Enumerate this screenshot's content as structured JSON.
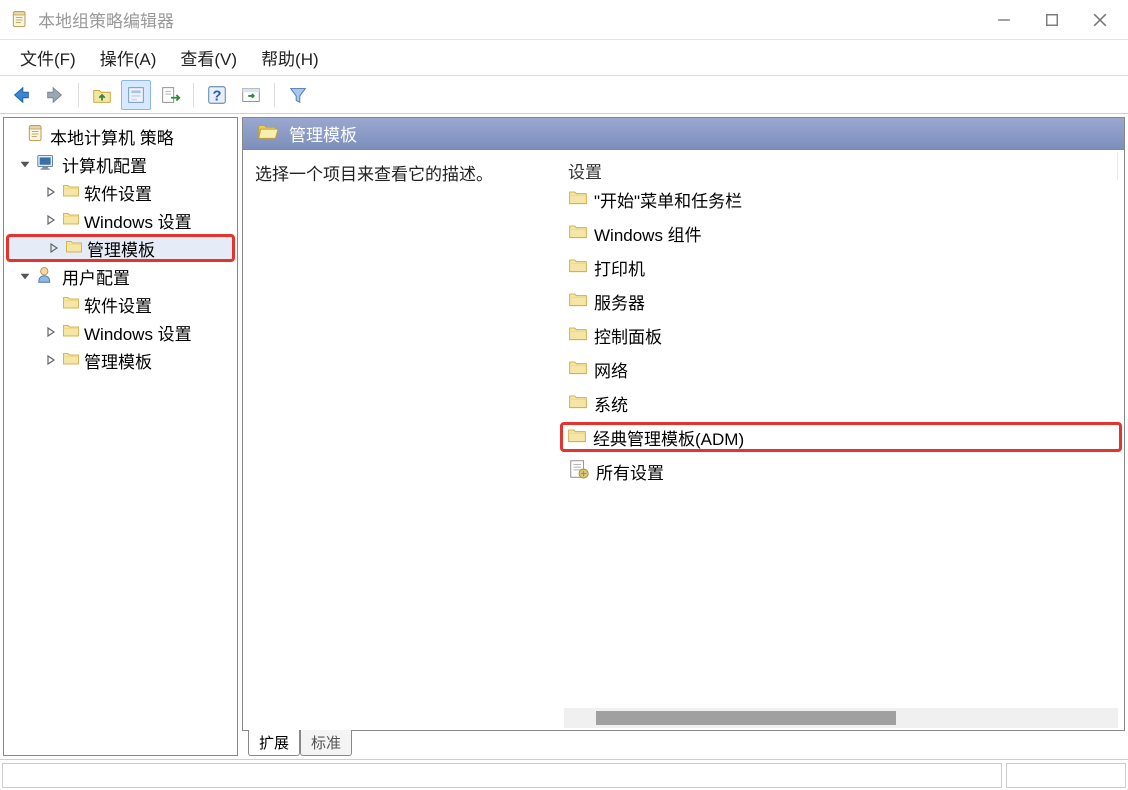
{
  "window": {
    "title": "本地组策略编辑器"
  },
  "menu": {
    "file": "文件(F)",
    "action": "操作(A)",
    "view": "查看(V)",
    "help": "帮助(H)"
  },
  "tree": {
    "root": "本地计算机 策略",
    "computer": "计算机配置",
    "computer_children": {
      "software": "软件设置",
      "windows": "Windows 设置",
      "admin_templates": "管理模板"
    },
    "user": "用户配置",
    "user_children": {
      "software": "软件设置",
      "windows": "Windows 设置",
      "admin_templates": "管理模板"
    }
  },
  "right": {
    "header": "管理模板",
    "description_prompt": "选择一个项目来查看它的描述。",
    "settings_header": "设置",
    "items": {
      "start_taskbar": "\"开始\"菜单和任务栏",
      "windows_components": "Windows 组件",
      "printers": "打印机",
      "servers": "服务器",
      "control_panel": "控制面板",
      "network": "网络",
      "system": "系统",
      "classic_adm": "经典管理模板(ADM)",
      "all_settings": "所有设置"
    }
  },
  "tabs": {
    "extended": "扩展",
    "standard": "标准"
  }
}
